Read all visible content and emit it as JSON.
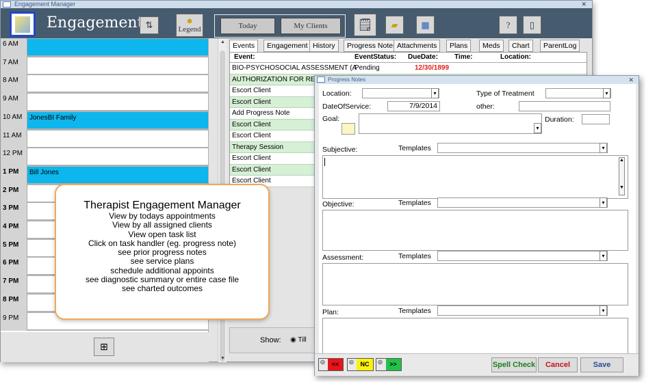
{
  "main_window": {
    "title": "Engagement Manager",
    "heading": "Engagements",
    "legend_label": "Legend",
    "today_label": "Today",
    "my_clients_label": "My Clients",
    "icons": [
      "sort-icon",
      "legend-icon",
      "notepad-icon",
      "folder-icon",
      "calendar-icon",
      "help-icon",
      "exit-icon"
    ]
  },
  "calendar": {
    "rows": [
      {
        "time": "6 AM",
        "entry": "",
        "booked": true,
        "bold": false
      },
      {
        "time": "7 AM",
        "entry": "",
        "booked": false,
        "bold": false
      },
      {
        "time": "8 AM",
        "entry": "",
        "booked": false,
        "bold": false
      },
      {
        "time": "9 AM",
        "entry": "",
        "booked": false,
        "bold": false
      },
      {
        "time": "10 AM",
        "entry": "JonesBI Family",
        "booked": true,
        "bold": false
      },
      {
        "time": "11 AM",
        "entry": "",
        "booked": false,
        "bold": false
      },
      {
        "time": "12 PM",
        "entry": "",
        "booked": false,
        "bold": false
      },
      {
        "time": "1 PM",
        "entry": "Bill Jones",
        "booked": true,
        "bold": true
      },
      {
        "time": "2 PM",
        "entry": "",
        "booked": false,
        "bold": true
      },
      {
        "time": "3 PM",
        "entry": "",
        "booked": false,
        "bold": true
      },
      {
        "time": "4 PM",
        "entry": "",
        "booked": false,
        "bold": true
      },
      {
        "time": "5 PM",
        "entry": "",
        "booked": false,
        "bold": true
      },
      {
        "time": "6 PM",
        "entry": "",
        "booked": false,
        "bold": true
      },
      {
        "time": "7 PM",
        "entry": "",
        "booked": false,
        "bold": true
      },
      {
        "time": "8 PM",
        "entry": "",
        "booked": false,
        "bold": true
      },
      {
        "time": "9 PM",
        "entry": "",
        "booked": false,
        "bold": false
      }
    ]
  },
  "tabs": [
    "Events",
    "Engagement",
    "History",
    "Progress Notes",
    "Attachments",
    "Plans",
    "Meds",
    "Chart",
    "ParentLog"
  ],
  "events": {
    "headers": {
      "event": "Event:",
      "status": "EventStatus:",
      "due": "DueDate:",
      "time": "Time:",
      "location": "Location:"
    },
    "rows": [
      {
        "name": "BIO-PSYCHOSOCIAL ASSESSMENT (A",
        "status": "Pending",
        "due": "12/30/1899",
        "alt": false
      },
      {
        "name": "AUTHORIZATION FOR REL",
        "status": "",
        "due": "",
        "alt": true
      },
      {
        "name": "Escort Client",
        "status": "",
        "due": "",
        "alt": false
      },
      {
        "name": "Escort Client",
        "status": "",
        "due": "",
        "alt": true
      },
      {
        "name": "Add Progress Note",
        "status": "",
        "due": "",
        "alt": false
      },
      {
        "name": "Escort Client",
        "status": "",
        "due": "",
        "alt": true
      },
      {
        "name": "Escort Client",
        "status": "",
        "due": "",
        "alt": false
      },
      {
        "name": "Therapy Session",
        "status": "",
        "due": "",
        "alt": true
      },
      {
        "name": "Escort Client",
        "status": "",
        "due": "",
        "alt": false
      },
      {
        "name": "Escort Client",
        "status": "",
        "due": "",
        "alt": true
      },
      {
        "name": "Escort Client",
        "status": "",
        "due": "",
        "alt": false
      }
    ]
  },
  "show_bar": {
    "label": "Show:",
    "option": "Till"
  },
  "callout": {
    "heading": "Therapist Engagement Manager",
    "lines": [
      "View by todays appointments",
      "View by all assigned clients",
      "View open task list",
      "Click on task handler (eg. progress note)",
      "see prior progress notes",
      "see service plans",
      "schedule additional appoints",
      "see diagnostic summary or entire case file",
      "see charted outcomes"
    ]
  },
  "progress_notes": {
    "title": "Progress Notes",
    "location_label": "Location:",
    "location_value": "",
    "type_label": "Type of Treatment",
    "type_value": "",
    "date_label": "DateOfService:",
    "date_value": "7/9/2014",
    "other_label": "other:",
    "goal_label": "Goal:",
    "duration_label": "Duration:",
    "templates_label": "Templates",
    "sections": [
      "Subjective:",
      "Objective:",
      "Assessment:",
      "Plan:"
    ],
    "nav": {
      "prev": "<<",
      "nc": "NC",
      "next": ">>"
    },
    "spell_check": "Spell Check",
    "cancel": "Cancel",
    "save": "Save",
    "colors": {
      "prev": "#e8141b",
      "nc": "#fbf20e",
      "next": "#22c24a",
      "spell": "#1a7f20",
      "cancel": "#c0141b",
      "save": "#2a4d92"
    }
  }
}
